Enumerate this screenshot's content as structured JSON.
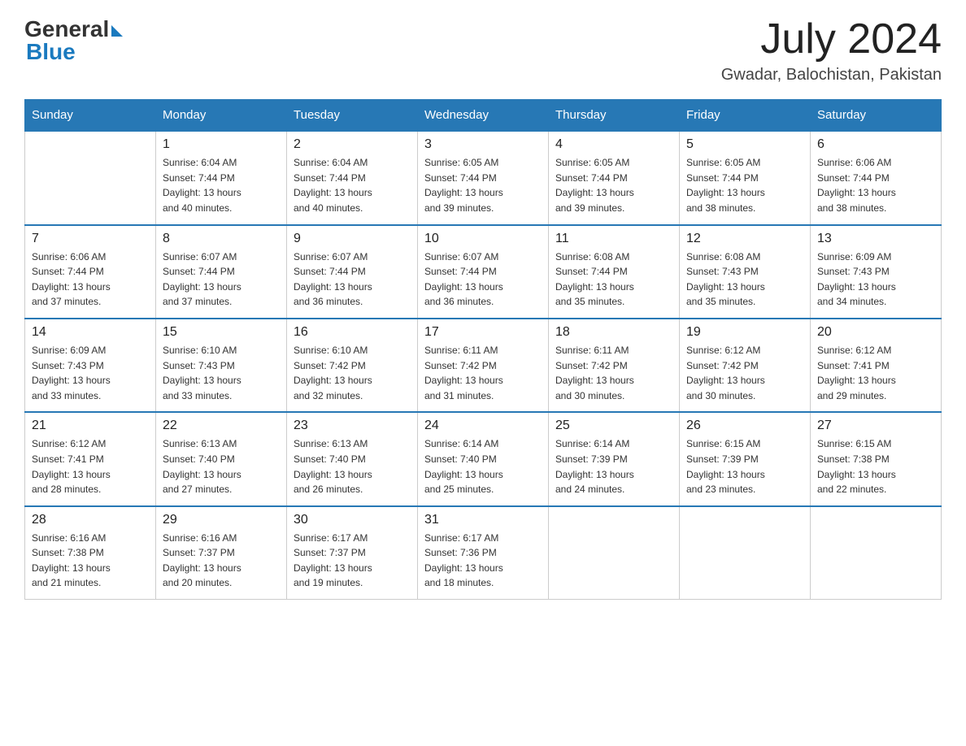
{
  "header": {
    "logo_general": "General",
    "logo_blue": "Blue",
    "month_title": "July 2024",
    "location": "Gwadar, Balochistan, Pakistan"
  },
  "days_of_week": [
    "Sunday",
    "Monday",
    "Tuesday",
    "Wednesday",
    "Thursday",
    "Friday",
    "Saturday"
  ],
  "weeks": [
    [
      {
        "day": "",
        "info": ""
      },
      {
        "day": "1",
        "info": "Sunrise: 6:04 AM\nSunset: 7:44 PM\nDaylight: 13 hours\nand 40 minutes."
      },
      {
        "day": "2",
        "info": "Sunrise: 6:04 AM\nSunset: 7:44 PM\nDaylight: 13 hours\nand 40 minutes."
      },
      {
        "day": "3",
        "info": "Sunrise: 6:05 AM\nSunset: 7:44 PM\nDaylight: 13 hours\nand 39 minutes."
      },
      {
        "day": "4",
        "info": "Sunrise: 6:05 AM\nSunset: 7:44 PM\nDaylight: 13 hours\nand 39 minutes."
      },
      {
        "day": "5",
        "info": "Sunrise: 6:05 AM\nSunset: 7:44 PM\nDaylight: 13 hours\nand 38 minutes."
      },
      {
        "day": "6",
        "info": "Sunrise: 6:06 AM\nSunset: 7:44 PM\nDaylight: 13 hours\nand 38 minutes."
      }
    ],
    [
      {
        "day": "7",
        "info": "Sunrise: 6:06 AM\nSunset: 7:44 PM\nDaylight: 13 hours\nand 37 minutes."
      },
      {
        "day": "8",
        "info": "Sunrise: 6:07 AM\nSunset: 7:44 PM\nDaylight: 13 hours\nand 37 minutes."
      },
      {
        "day": "9",
        "info": "Sunrise: 6:07 AM\nSunset: 7:44 PM\nDaylight: 13 hours\nand 36 minutes."
      },
      {
        "day": "10",
        "info": "Sunrise: 6:07 AM\nSunset: 7:44 PM\nDaylight: 13 hours\nand 36 minutes."
      },
      {
        "day": "11",
        "info": "Sunrise: 6:08 AM\nSunset: 7:44 PM\nDaylight: 13 hours\nand 35 minutes."
      },
      {
        "day": "12",
        "info": "Sunrise: 6:08 AM\nSunset: 7:43 PM\nDaylight: 13 hours\nand 35 minutes."
      },
      {
        "day": "13",
        "info": "Sunrise: 6:09 AM\nSunset: 7:43 PM\nDaylight: 13 hours\nand 34 minutes."
      }
    ],
    [
      {
        "day": "14",
        "info": "Sunrise: 6:09 AM\nSunset: 7:43 PM\nDaylight: 13 hours\nand 33 minutes."
      },
      {
        "day": "15",
        "info": "Sunrise: 6:10 AM\nSunset: 7:43 PM\nDaylight: 13 hours\nand 33 minutes."
      },
      {
        "day": "16",
        "info": "Sunrise: 6:10 AM\nSunset: 7:42 PM\nDaylight: 13 hours\nand 32 minutes."
      },
      {
        "day": "17",
        "info": "Sunrise: 6:11 AM\nSunset: 7:42 PM\nDaylight: 13 hours\nand 31 minutes."
      },
      {
        "day": "18",
        "info": "Sunrise: 6:11 AM\nSunset: 7:42 PM\nDaylight: 13 hours\nand 30 minutes."
      },
      {
        "day": "19",
        "info": "Sunrise: 6:12 AM\nSunset: 7:42 PM\nDaylight: 13 hours\nand 30 minutes."
      },
      {
        "day": "20",
        "info": "Sunrise: 6:12 AM\nSunset: 7:41 PM\nDaylight: 13 hours\nand 29 minutes."
      }
    ],
    [
      {
        "day": "21",
        "info": "Sunrise: 6:12 AM\nSunset: 7:41 PM\nDaylight: 13 hours\nand 28 minutes."
      },
      {
        "day": "22",
        "info": "Sunrise: 6:13 AM\nSunset: 7:40 PM\nDaylight: 13 hours\nand 27 minutes."
      },
      {
        "day": "23",
        "info": "Sunrise: 6:13 AM\nSunset: 7:40 PM\nDaylight: 13 hours\nand 26 minutes."
      },
      {
        "day": "24",
        "info": "Sunrise: 6:14 AM\nSunset: 7:40 PM\nDaylight: 13 hours\nand 25 minutes."
      },
      {
        "day": "25",
        "info": "Sunrise: 6:14 AM\nSunset: 7:39 PM\nDaylight: 13 hours\nand 24 minutes."
      },
      {
        "day": "26",
        "info": "Sunrise: 6:15 AM\nSunset: 7:39 PM\nDaylight: 13 hours\nand 23 minutes."
      },
      {
        "day": "27",
        "info": "Sunrise: 6:15 AM\nSunset: 7:38 PM\nDaylight: 13 hours\nand 22 minutes."
      }
    ],
    [
      {
        "day": "28",
        "info": "Sunrise: 6:16 AM\nSunset: 7:38 PM\nDaylight: 13 hours\nand 21 minutes."
      },
      {
        "day": "29",
        "info": "Sunrise: 6:16 AM\nSunset: 7:37 PM\nDaylight: 13 hours\nand 20 minutes."
      },
      {
        "day": "30",
        "info": "Sunrise: 6:17 AM\nSunset: 7:37 PM\nDaylight: 13 hours\nand 19 minutes."
      },
      {
        "day": "31",
        "info": "Sunrise: 6:17 AM\nSunset: 7:36 PM\nDaylight: 13 hours\nand 18 minutes."
      },
      {
        "day": "",
        "info": ""
      },
      {
        "day": "",
        "info": ""
      },
      {
        "day": "",
        "info": ""
      }
    ]
  ]
}
